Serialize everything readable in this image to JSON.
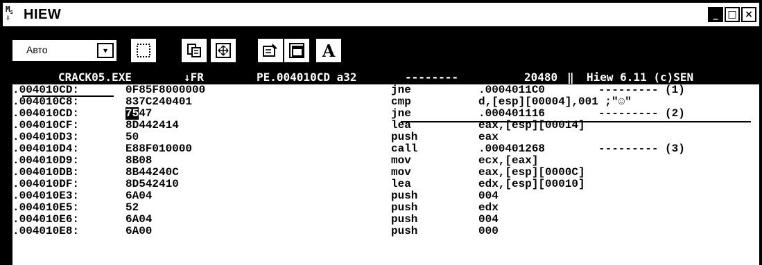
{
  "window": {
    "icon_label": "MS\nDOS",
    "title": "HIEW",
    "minimize_label": "_",
    "maximize_label": "□",
    "close_label": "×"
  },
  "toolbar": {
    "font_select_value": "Авто",
    "font_select_arrow": "▾",
    "letter_button": "A",
    "icons": [
      "select-icon",
      "copy-icon",
      "fullscreen-icon",
      "properties-icon",
      "background-icon",
      "font-icon"
    ]
  },
  "header": {
    "filename": "CRACK05.EXE",
    "mode": "↓FR",
    "offset": "PE.004010CD a32",
    "dashes": "--------",
    "size": "20480",
    "version": "Hiew 6.11 (c)SEN"
  },
  "rows": [
    {
      "addr": ".004010CD:",
      "hex": "0F85F8000000",
      "mnem": "jne",
      "ops": ".0004011C0",
      "cmt": "--------- (1)"
    },
    {
      "addr": ".004010C8:",
      "hex": "837C240401",
      "mnem": "cmp",
      "ops": "d,[esp][00004],001 ;\"☺\"",
      "cmt": ""
    },
    {
      "addr": ".004010CD:",
      "hex_hl": "75",
      "hex_rest": "47",
      "mnem": "jne",
      "ops": ".000401116",
      "cmt": "--------- (2)"
    },
    {
      "addr": ".004010CF:",
      "hex": "8D442414",
      "mnem": "lea",
      "ops": "eax,[esp][00014]",
      "cmt": ""
    },
    {
      "addr": ".004010D3:",
      "hex": "50",
      "mnem": "push",
      "ops": "eax",
      "cmt": ""
    },
    {
      "addr": ".004010D4:",
      "hex": "E88F010000",
      "mnem": "call",
      "ops": ".000401268",
      "cmt": "--------- (3)"
    },
    {
      "addr": ".004010D9:",
      "hex": "8B08",
      "mnem": "mov",
      "ops": "ecx,[eax]",
      "cmt": ""
    },
    {
      "addr": ".004010DB:",
      "hex": "8B44240C",
      "mnem": "mov",
      "ops": "eax,[esp][0000C]",
      "cmt": ""
    },
    {
      "addr": ".004010DF:",
      "hex": "8D542410",
      "mnem": "lea",
      "ops": "edx,[esp][00010]",
      "cmt": ""
    },
    {
      "addr": ".004010E3:",
      "hex": "6A04",
      "mnem": "push",
      "ops": "004",
      "cmt": ""
    },
    {
      "addr": ".004010E5:",
      "hex": "52",
      "mnem": "push",
      "ops": "edx",
      "cmt": ""
    },
    {
      "addr": ".004010E6:",
      "hex": "6A04",
      "mnem": "push",
      "ops": "004",
      "cmt": ""
    },
    {
      "addr": ".004010E8:",
      "hex": "6A00",
      "mnem": "push",
      "ops": "000",
      "cmt": ""
    }
  ],
  "colors": {
    "background": "#000000",
    "foreground": "#ffffff"
  }
}
